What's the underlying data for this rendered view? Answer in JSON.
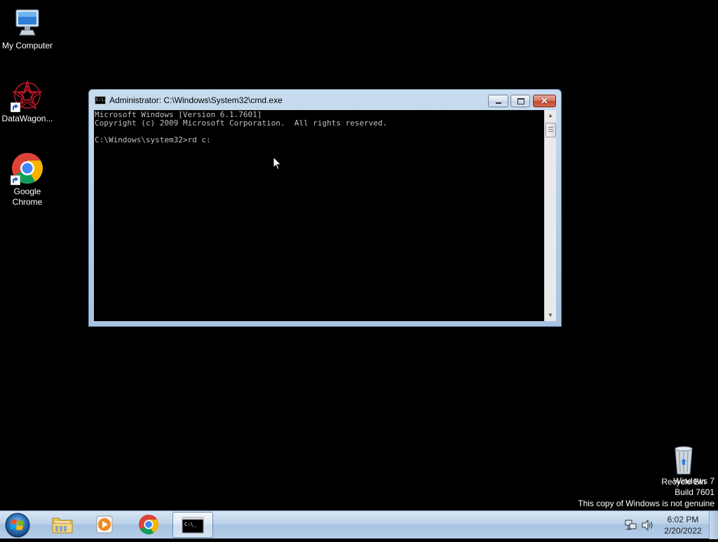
{
  "desktop": {
    "icons": [
      {
        "label": "My Computer"
      },
      {
        "label": "DataWagon..."
      },
      {
        "label": "Google Chrome"
      },
      {
        "label": "Recycle Bin"
      }
    ]
  },
  "window": {
    "title": "Administrator: C:\\Windows\\System32\\cmd.exe",
    "icon_text": "C:\\.",
    "close_glyph": "✕",
    "console_lines": [
      "Microsoft Windows [Version 6.1.7601]",
      "Copyright (c) 2009 Microsoft Corporation.  All rights reserved.",
      "",
      "C:\\Windows\\system32>rd c:"
    ]
  },
  "watermark": {
    "line1": "Windows 7",
    "line2": "Build 7601",
    "line3": "This copy of Windows is not genuine"
  },
  "taskbar": {
    "cmd_icon_text": "C:\\_",
    "clock_time": "6:02 PM",
    "clock_date": "2/20/2022"
  },
  "colors": {
    "desktop_bg": "#000000",
    "console_bg": "#000000",
    "console_text": "#c0c0c0",
    "taskbar": "#bcd3ea"
  }
}
